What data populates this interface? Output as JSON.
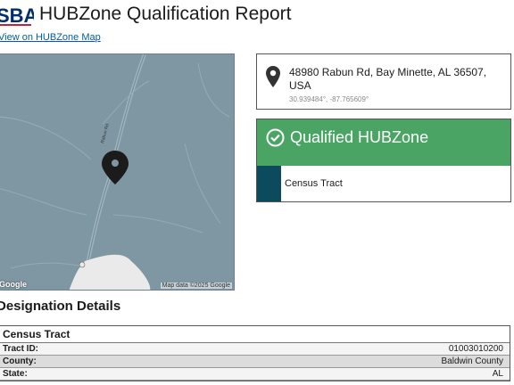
{
  "header": {
    "logo_text": "SBA",
    "title": "HUBZone Qualification Report",
    "map_link": "View on HUBZone Map"
  },
  "map": {
    "google_label": "Google",
    "credit": "Map data ©2025 Google",
    "road_label": "Rabun Rd"
  },
  "location": {
    "address": "48980 Rabun Rd, Bay Minette, AL 36507, USA",
    "coordinates": "30.939484°, -87.765609°"
  },
  "qualification": {
    "status": "Qualified HUBZone",
    "layer_label": "Census Tract",
    "status_color": "#4aa564",
    "layer_color": "#0c4a5e"
  },
  "designation": {
    "heading": "Designation Details",
    "section_title": "Census Tract",
    "rows": [
      {
        "key": "Tract ID:",
        "value": "01003010200"
      },
      {
        "key": "County:",
        "value": "Baldwin County"
      },
      {
        "key": "State:",
        "value": "AL"
      }
    ]
  }
}
